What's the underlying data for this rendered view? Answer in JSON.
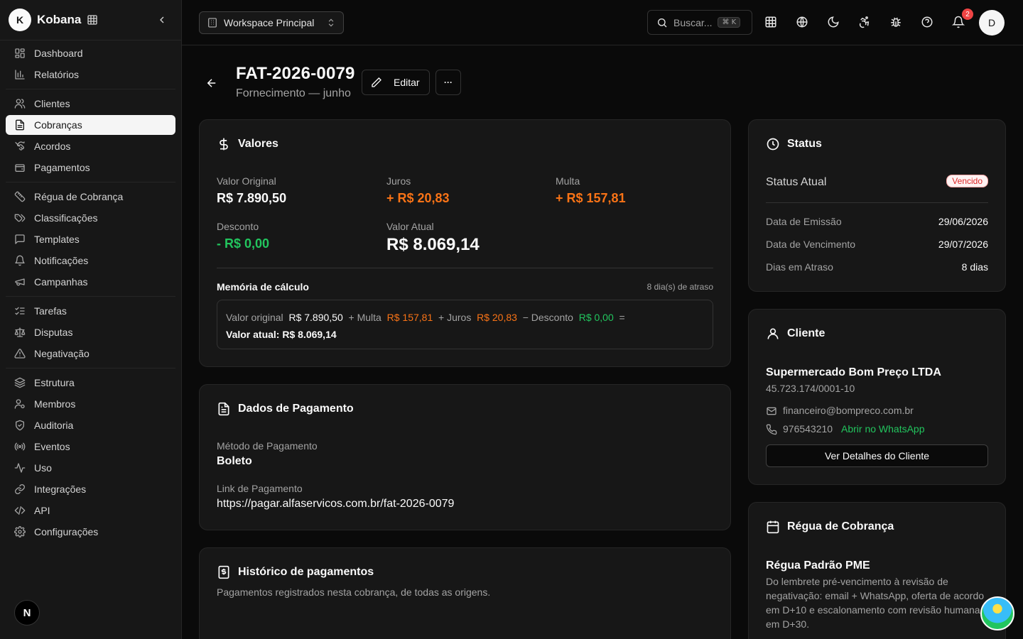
{
  "app": {
    "logo_letter": "K",
    "name": "Kobana"
  },
  "sidebar": {
    "groups": [
      [
        {
          "label": "Dashboard",
          "icon": "layout-dashboard-icon"
        },
        {
          "label": "Relatórios",
          "icon": "bar-chart-icon"
        }
      ],
      [
        {
          "label": "Clientes",
          "icon": "users-icon"
        },
        {
          "label": "Cobranças",
          "icon": "receipt-icon",
          "active": true
        },
        {
          "label": "Acordos",
          "icon": "handshake-icon"
        },
        {
          "label": "Pagamentos",
          "icon": "wallet-icon"
        }
      ],
      [
        {
          "label": "Régua de Cobrança",
          "icon": "ruler-icon"
        },
        {
          "label": "Classificações",
          "icon": "tags-icon"
        },
        {
          "label": "Templates",
          "icon": "message-square-icon"
        },
        {
          "label": "Notificações",
          "icon": "bell-icon"
        },
        {
          "label": "Campanhas",
          "icon": "megaphone-icon"
        }
      ],
      [
        {
          "label": "Tarefas",
          "icon": "list-checks-icon"
        },
        {
          "label": "Disputas",
          "icon": "scale-icon"
        },
        {
          "label": "Negativação",
          "icon": "alert-triangle-icon"
        }
      ],
      [
        {
          "label": "Estrutura",
          "icon": "layers-icon"
        },
        {
          "label": "Membros",
          "icon": "user-cog-icon"
        },
        {
          "label": "Auditoria",
          "icon": "shield-icon"
        },
        {
          "label": "Eventos",
          "icon": "radio-icon"
        },
        {
          "label": "Uso",
          "icon": "activity-icon"
        },
        {
          "label": "Integrações",
          "icon": "link-icon"
        },
        {
          "label": "API",
          "icon": "code-icon"
        },
        {
          "label": "Configurações",
          "icon": "settings-icon"
        }
      ]
    ],
    "bottom_badge": "N"
  },
  "topbar": {
    "workspace": "Workspace Principal",
    "search_placeholder": "Buscar...",
    "search_shortcut": "⌘ K",
    "notifications_count": "2",
    "avatar_letter": "D"
  },
  "header": {
    "title": "FAT-2026-0079",
    "subtitle": "Fornecimento — junho",
    "edit_label": "Editar",
    "more_label": "···"
  },
  "valores": {
    "title": "Valores",
    "valor_original_label": "Valor Original",
    "valor_original": "R$ 7.890,50",
    "juros_label": "Juros",
    "juros": "+ R$ 20,83",
    "multa_label": "Multa",
    "multa": "+ R$ 157,81",
    "desconto_label": "Desconto",
    "desconto": "- R$ 0,00",
    "valor_atual_label": "Valor Atual",
    "valor_atual": "R$ 8.069,14",
    "memoria_label": "Memória de cálculo",
    "atraso_note": "8 dia(s) de atraso",
    "memo": {
      "t1": "Valor original",
      "v1": "R$ 7.890,50",
      "t2": "+ Multa",
      "v2": "R$ 157,81",
      "t3": "+ Juros",
      "v3": "R$ 20,83",
      "t4": "− Desconto",
      "v4": "R$ 0,00",
      "eq": "=",
      "total": "Valor atual: R$ 8.069,14"
    }
  },
  "pagamento": {
    "title": "Dados de Pagamento",
    "metodo_label": "Método de Pagamento",
    "metodo": "Boleto",
    "link_label": "Link de Pagamento",
    "link": "https://pagar.alfaservicos.com.br/fat-2026-0079"
  },
  "historico": {
    "title": "Histórico de pagamentos",
    "description": "Pagamentos registrados nesta cobrança, de todas as origens."
  },
  "status": {
    "title": "Status",
    "atual_label": "Status Atual",
    "atual": "Vencido",
    "emissao_label": "Data de Emissão",
    "emissao": "29/06/2026",
    "vencimento_label": "Data de Vencimento",
    "vencimento": "29/07/2026",
    "atraso_label": "Dias em Atraso",
    "atraso": "8 dias"
  },
  "cliente": {
    "title": "Cliente",
    "nome": "Supermercado Bom Preço LTDA",
    "cnpj": "45.723.174/0001-10",
    "email": "financeiro@bompreco.com.br",
    "telefone": "976543210",
    "whatsapp_link": "Abrir no WhatsApp",
    "detalhes_button": "Ver Detalhes do Cliente"
  },
  "regua": {
    "title": "Régua de Cobrança",
    "nome": "Régua Padrão PME",
    "descricao": "Do lembrete pré-vencimento à revisão de negativação: email + WhatsApp, oferta de acordo em D+10 e escalonamento com revisão humana em D+30."
  },
  "colors": {
    "orange": "#f97316",
    "green": "#22c55e",
    "red": "#ef4444",
    "card_bg": "#171717",
    "page_bg": "#0a0a0a"
  }
}
